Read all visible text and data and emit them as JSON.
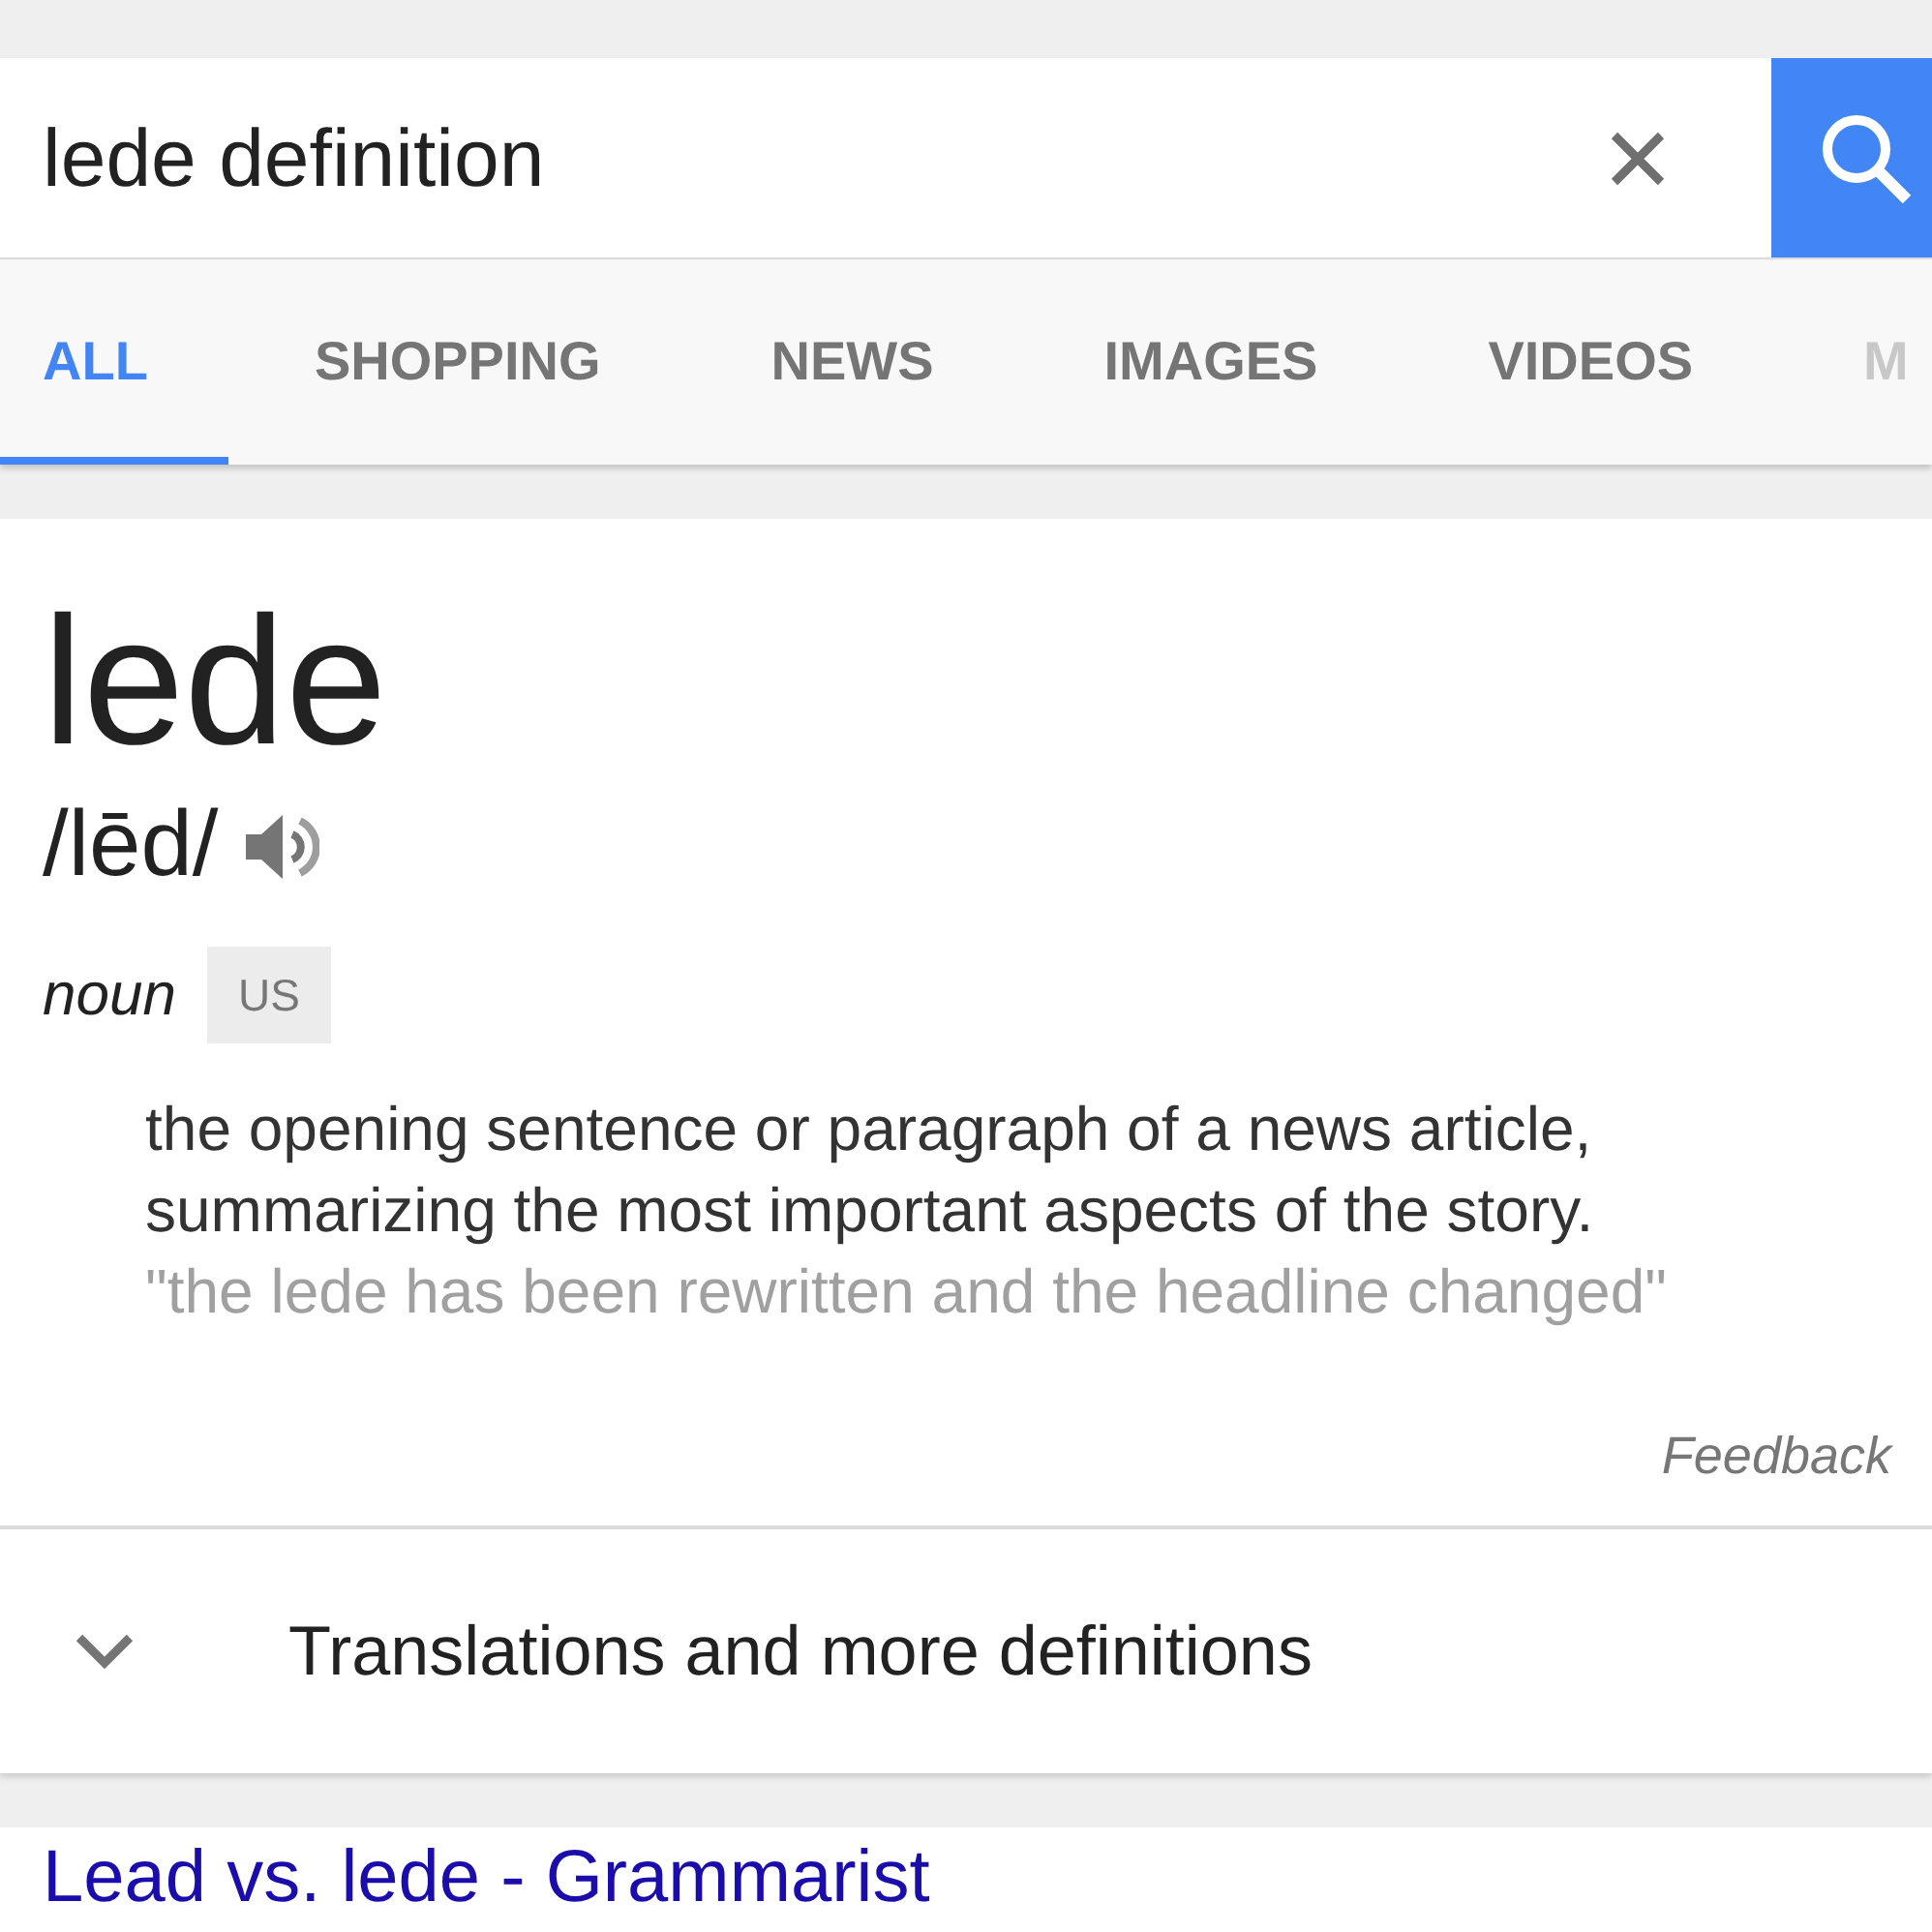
{
  "search": {
    "query": "lede definition"
  },
  "tabs": [
    {
      "label": "ALL",
      "selected": true,
      "faded": false
    },
    {
      "label": "SHOPPING",
      "selected": false,
      "faded": false
    },
    {
      "label": "NEWS",
      "selected": false,
      "faded": false
    },
    {
      "label": "IMAGES",
      "selected": false,
      "faded": false
    },
    {
      "label": "VIDEOS",
      "selected": false,
      "faded": false
    },
    {
      "label": "M",
      "selected": false,
      "faded": true
    }
  ],
  "entry": {
    "word": "lede",
    "phonetic": "/lēd/",
    "part_of_speech": "noun",
    "region": "US",
    "senses": [
      {
        "definition": "the opening sentence or paragraph of a news article, summarizing the most important aspects of the story.",
        "example": "\"the lede has been rewritten and the headline changed\""
      }
    ],
    "feedback": "Feedback"
  },
  "more": {
    "label": "Translations and more definitions",
    "expanded": false
  },
  "results": [
    {
      "title": "Lead vs. lede - Grammarist"
    }
  ]
}
